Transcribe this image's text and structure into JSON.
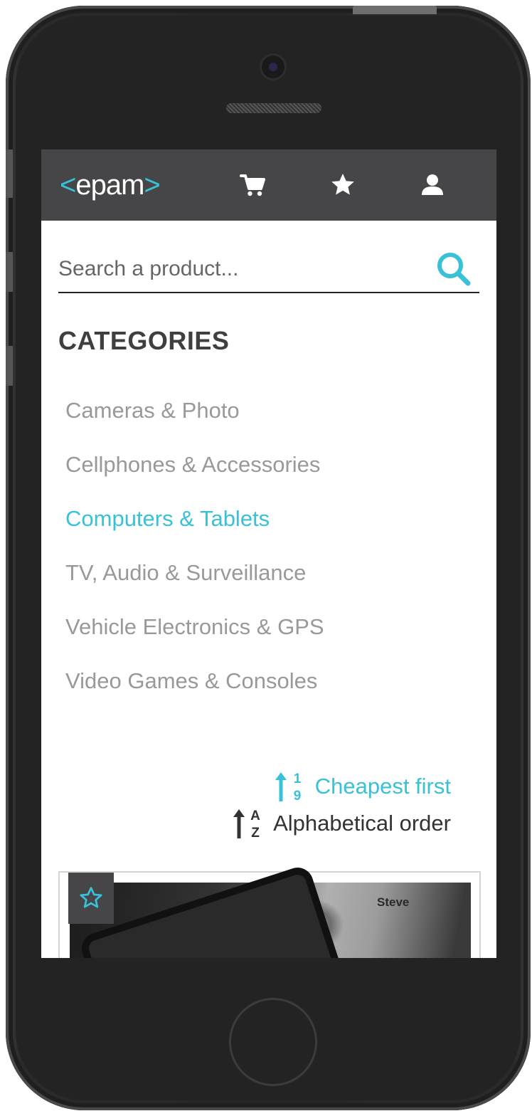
{
  "app": {
    "logo_text": "epam",
    "logo_left": "<",
    "logo_right": ">"
  },
  "header": {
    "icons": [
      "cart-icon",
      "star-icon",
      "user-icon"
    ]
  },
  "search": {
    "placeholder": "Search a product..."
  },
  "categories": {
    "title": "CATEGORIES",
    "items": [
      {
        "label": "Cameras & Photo",
        "active": false
      },
      {
        "label": "Cellphones & Accessories",
        "active": false
      },
      {
        "label": "Computers & Tablets",
        "active": true
      },
      {
        "label": "TV, Audio & Surveillance",
        "active": false
      },
      {
        "label": "Vehicle Electronics & GPS",
        "active": false
      },
      {
        "label": "Video Games & Consoles",
        "active": false
      }
    ]
  },
  "sort": {
    "cheapest": {
      "label": "Cheapest first",
      "icon_digits": [
        "1",
        "9"
      ],
      "active": true
    },
    "alpha": {
      "label": "Alphabetical order",
      "icon_letters": [
        "A",
        "Z"
      ],
      "active": false
    }
  },
  "product": {
    "photo_text": "Steve",
    "favorite_icon": "star-outline-icon"
  },
  "colors": {
    "accent": "#39c2d7",
    "header": "#464547",
    "muted_text": "#999999",
    "dark_text": "#3f3f3f"
  }
}
